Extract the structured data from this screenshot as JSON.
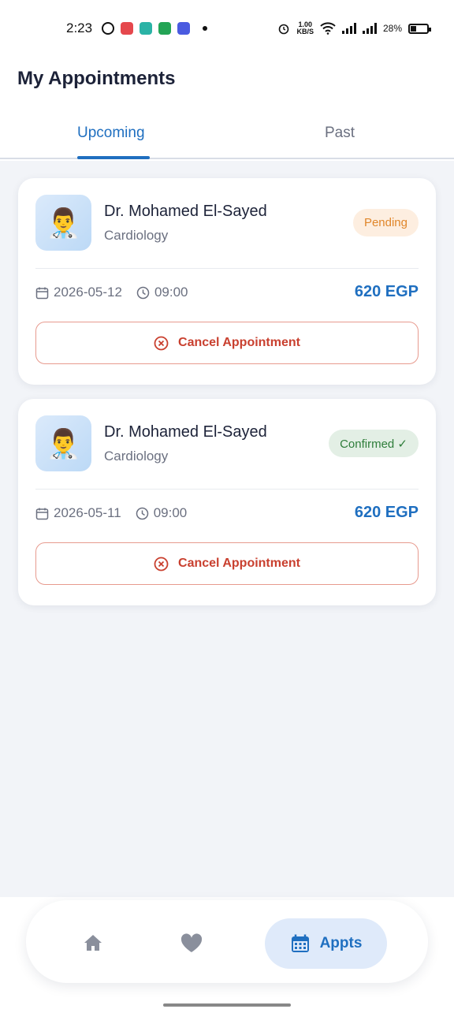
{
  "status_bar": {
    "time": "2:23",
    "net_speed_value": "1.00",
    "net_speed_unit": "KB/S",
    "battery": "28%"
  },
  "header": {
    "title": "My Appointments",
    "tabs": [
      {
        "label": "Upcoming",
        "active": true
      },
      {
        "label": "Past",
        "active": false
      }
    ]
  },
  "appointments": [
    {
      "doctor": "Dr. Mohamed El-Sayed",
      "specialty": "Cardiology",
      "status": "Pending",
      "date": "2026-05-12",
      "time": "09:00",
      "price": "620 EGP",
      "cancel_label": "Cancel Appointment"
    },
    {
      "doctor": "Dr. Mohamed El-Sayed",
      "specialty": "Cardiology",
      "status": "Confirmed ✓",
      "date": "2026-05-11",
      "time": "09:00",
      "price": "620 EGP",
      "cancel_label": "Cancel Appointment"
    }
  ],
  "bottom_nav": {
    "items": [
      {
        "icon": "home-icon",
        "active": false
      },
      {
        "icon": "heart-icon",
        "active": false
      },
      {
        "icon": "calendar-icon",
        "label": "Appts",
        "active": true
      }
    ]
  },
  "colors": {
    "accent": "#1f6fc0",
    "pending": "#e0862a",
    "confirmed": "#2e7d3a",
    "danger": "#c9402f"
  }
}
